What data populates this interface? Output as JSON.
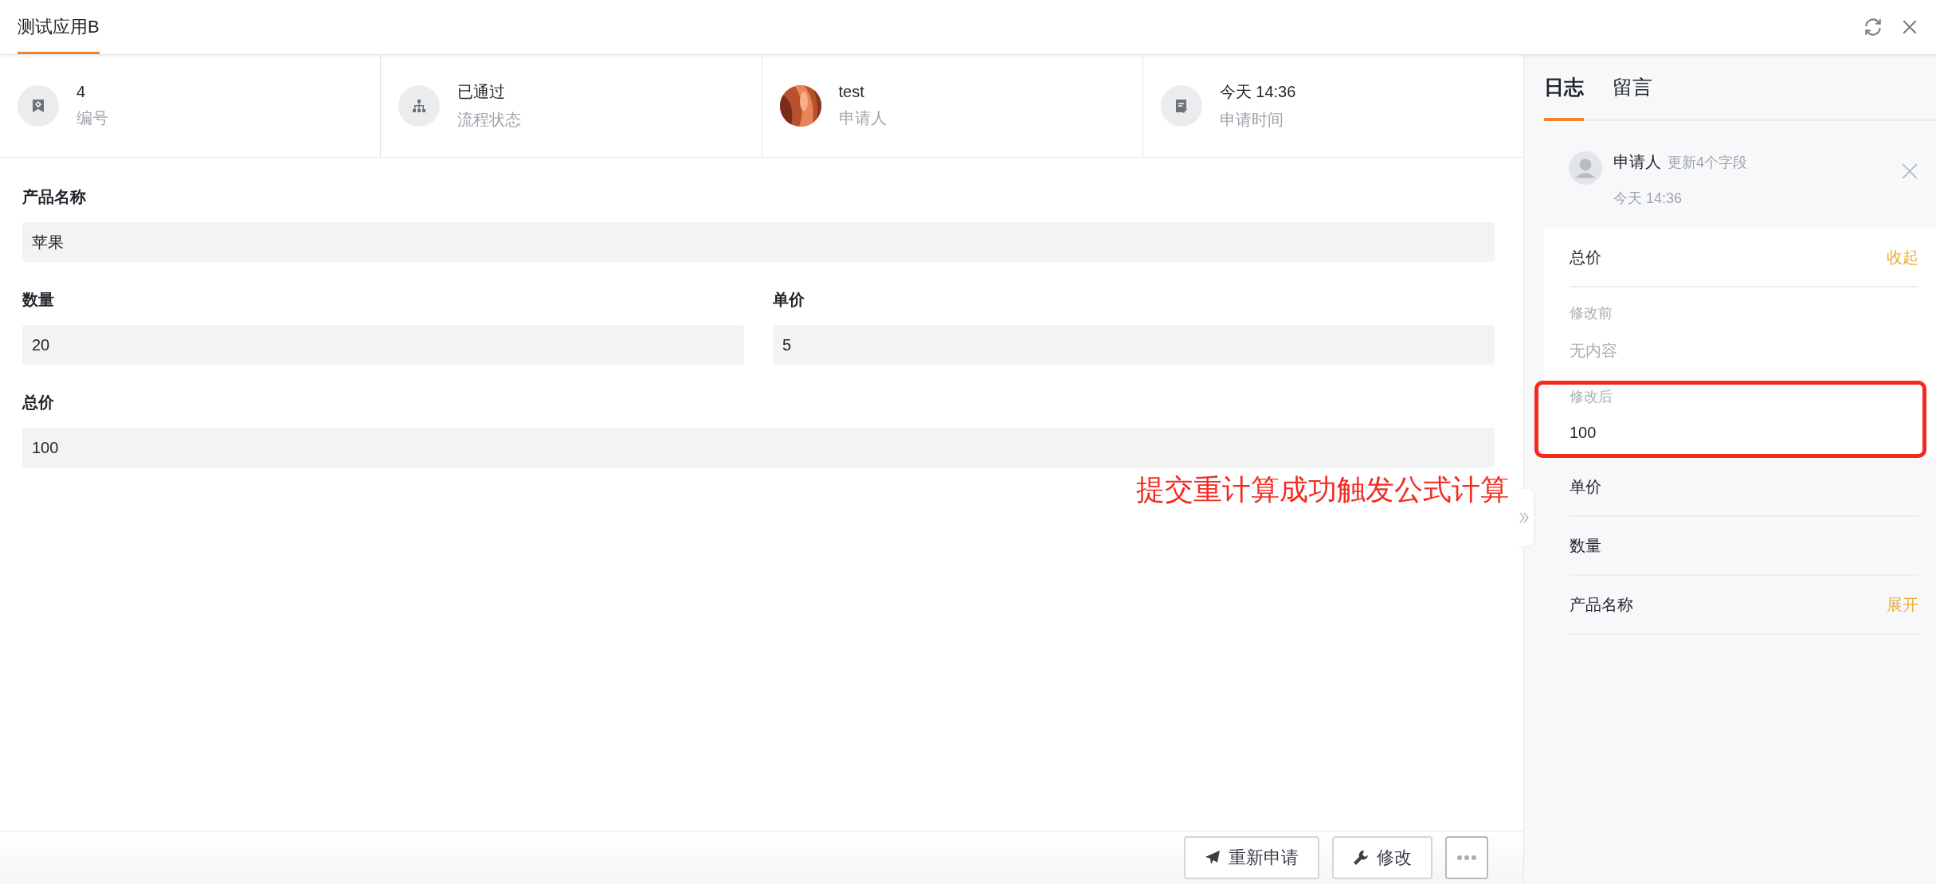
{
  "app_tab": {
    "label": "测试应用B",
    "selected": true
  },
  "info_cells": [
    {
      "kind": "tag",
      "value": "4",
      "label": "编号"
    },
    {
      "kind": "flow",
      "value": "已通过",
      "label": "流程状态"
    },
    {
      "kind": "avatar",
      "value": "test",
      "label": "申请人"
    },
    {
      "kind": "note",
      "value": "今天 14:36",
      "label": "申请时间"
    }
  ],
  "form": {
    "rows": [
      [
        {
          "label": "产品名称",
          "value": "苹果"
        }
      ],
      [
        {
          "label": "数量",
          "value": "20"
        },
        {
          "label": "单价",
          "value": "5"
        }
      ],
      [
        {
          "label": "总价",
          "value": "100"
        }
      ]
    ]
  },
  "annotation": "提交重计算成功触发公式计算",
  "log": {
    "tabs": [
      {
        "label": "日志",
        "selected": true
      },
      {
        "label": "留言",
        "selected": false
      }
    ],
    "entry": {
      "user": "申请人",
      "action": "更新4个字段",
      "time": "今天 14:36"
    },
    "fields": [
      {
        "name": "总价",
        "expanded": true,
        "toggle": "收起",
        "before_label": "修改前",
        "before": "无内容",
        "after_label": "修改后",
        "after": "100",
        "highlighted": true
      },
      {
        "name": "单价",
        "expanded": false
      },
      {
        "name": "数量",
        "expanded": false
      },
      {
        "name": "产品名称",
        "expanded": false,
        "toggle": "展开"
      }
    ]
  },
  "buttons": [
    {
      "kind": "send",
      "label": "重新申请"
    },
    {
      "kind": "wrench",
      "label": "修改"
    },
    {
      "kind": "more"
    }
  ]
}
